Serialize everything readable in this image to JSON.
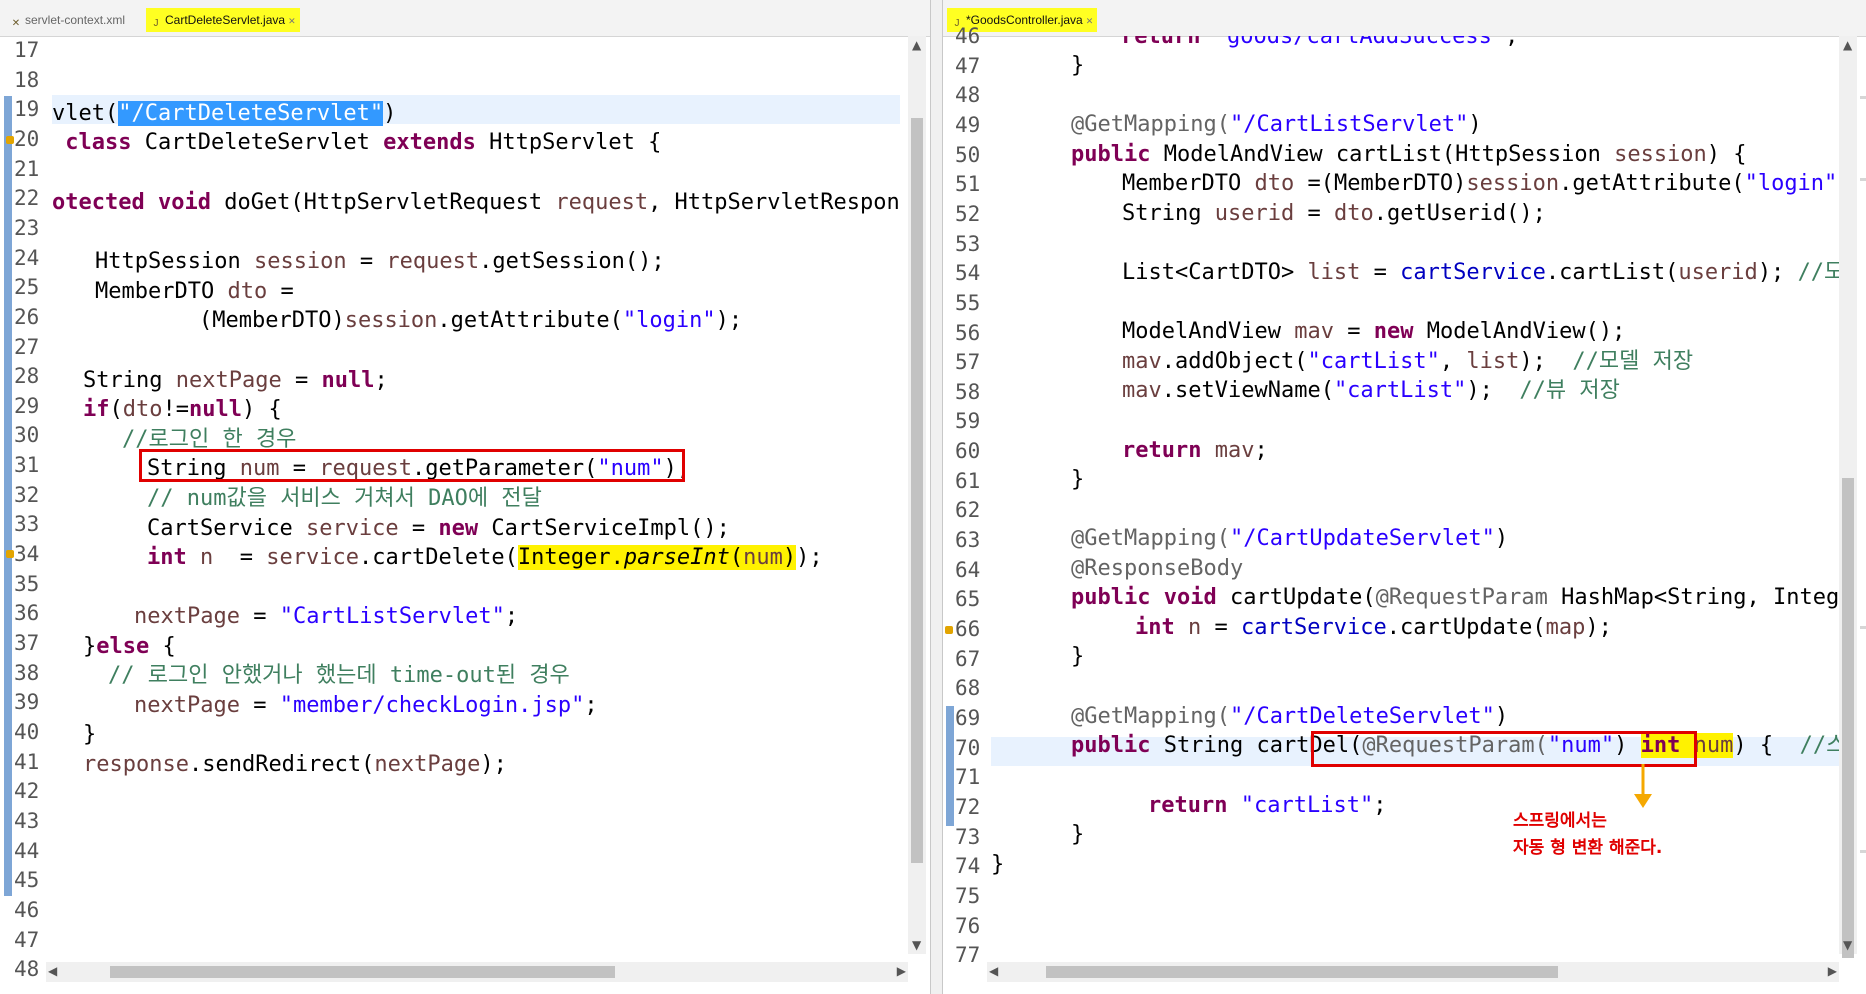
{
  "left": {
    "tabs": [
      {
        "label": "servlet-context.xml",
        "active": false
      },
      {
        "label": "CartDeleteServlet.java",
        "active": true
      }
    ],
    "line_numbers": [
      "17",
      "18",
      "19",
      "20",
      "21",
      "22",
      "23",
      "24",
      "25",
      "26",
      "27",
      "28",
      "29",
      "30",
      "31",
      "32",
      "33",
      "34",
      "35",
      "36",
      "37",
      "38",
      "39",
      "40",
      "41",
      "42",
      "43",
      "44",
      "45",
      "46",
      "47",
      "48"
    ],
    "code": {
      "l19_a": "vlet(",
      "l19_sel": "\"/CartDeleteServlet\"",
      "l19_b": ")",
      "l20_kw1": "class",
      "l20_name": "CartDeleteServlet",
      "l20_kw2": "extends",
      "l20_rest": "HttpServlet {",
      "l22_a": "otected",
      "l22_kw": "void",
      "l22_b": "doGet(HttpServletRequest",
      "l22_v1": "request",
      "l22_c": ", HttpServletResponse r",
      "l24_a": "HttpSession",
      "l24_v": "session",
      "l24_b": "=",
      "l24_v2": "request",
      "l24_c": ".getSession();",
      "l25_a": "MemberDTO",
      "l25_v": "dto",
      "l25_b": "=",
      "l26_a": "(MemberDTO)",
      "l26_v": "session",
      "l26_b": ".getAttribute(",
      "l26_s": "\"login\"",
      "l26_c": ");",
      "l28_a": "String",
      "l28_v": "nextPage",
      "l28_b": "=",
      "l28_kw": "null",
      "l28_c": ";",
      "l29_kw": "if",
      "l29_a": "(",
      "l29_v": "dto",
      "l29_b": "!=",
      "l29_kw2": "null",
      "l29_c": ") {",
      "l30_cm": "//로그인 한 경우",
      "l31_a": "String",
      "l31_v": "num",
      "l31_b": "=",
      "l31_v2": "request",
      "l31_c": ".getParameter(",
      "l31_s": "\"num\"",
      "l31_d": ");",
      "l32_cm": "// num값을 서비스 거쳐서 DAO에 전달",
      "l33_a": "CartService",
      "l33_v": "service",
      "l33_b": "=",
      "l33_kw": "new",
      "l33_c": "CartServiceImpl();",
      "l34_kw": "int",
      "l34_v": "n",
      "l34_b": "=",
      "l34_v2": "service",
      "l34_c": ".cartDelete(",
      "l34_hl": "Integer.",
      "l34_it": "parseInt",
      "l34_d": "(",
      "l34_v3": "num",
      "l34_e": ")",
      "l34_f": ");",
      "l36_v": "nextPage",
      "l36_b": "=",
      "l36_s": "\"CartListServlet\"",
      "l36_c": ";",
      "l37_a": "}",
      "l37_kw": "else",
      "l37_b": "{",
      "l38_cm": "// 로그인 안했거나 했는데 time-out된 경우",
      "l39_v": "nextPage",
      "l39_b": "=",
      "l39_s": "\"member/checkLogin.jsp\"",
      "l39_c": ";",
      "l40_a": "}",
      "l41_v": "response",
      "l41_a": ".sendRedirect(",
      "l41_v2": "nextPage",
      "l41_b": ");"
    }
  },
  "right": {
    "tabs": [
      {
        "label": "*GoodsController.java",
        "active": true
      }
    ],
    "line_numbers": [
      "46",
      "47",
      "48",
      "49",
      "50",
      "51",
      "52",
      "53",
      "54",
      "55",
      "56",
      "57",
      "58",
      "59",
      "60",
      "61",
      "62",
      "63",
      "64",
      "65",
      "66",
      "67",
      "68",
      "69",
      "70",
      "71",
      "72",
      "73",
      "74",
      "75",
      "76",
      "77"
    ],
    "code": {
      "r46_kw": "return",
      "r46_s": "\"goods/cartAddSuccess\"",
      "r46_c": ";",
      "r47": "}",
      "r49_ann": "@GetMapping(",
      "r49_s": "\"/CartListServlet\"",
      "r49_b": ")",
      "r50_kw": "public",
      "r50_a": "ModelAndView cartList(HttpSession",
      "r50_v": "session",
      "r50_b": ") {",
      "r51_a": "MemberDTO",
      "r51_v": "dto",
      "r51_b": "=(MemberDTO)",
      "r51_v2": "session",
      "r51_c": ".getAttribute(",
      "r51_s": "\"login\"",
      "r51_d": ");",
      "r52_a": "String",
      "r52_v": "userid",
      "r52_b": "=",
      "r52_v2": "dto",
      "r52_c": ".getUserid();",
      "r54_a": "List<CartDTO>",
      "r54_v": "list",
      "r54_b": "=",
      "r54_f": "cartService",
      "r54_c": ".cartList(",
      "r54_v2": "userid",
      "r54_d": ");",
      "r54_cm": "//모델",
      "r56_a": "ModelAndView",
      "r56_v": "mav",
      "r56_b": "=",
      "r56_kw": "new",
      "r56_c": "ModelAndView();",
      "r57_v": "mav",
      "r57_a": ".addObject(",
      "r57_s": "\"cartList\"",
      "r57_b": ",",
      "r57_v2": "list",
      "r57_c": ");",
      "r57_cm": "//모델 저장",
      "r58_v": "mav",
      "r58_a": ".setViewName(",
      "r58_s": "\"cartList\"",
      "r58_b": ");",
      "r58_cm": "//뷰 저장",
      "r60_kw": "return",
      "r60_v": "mav",
      "r60_c": ";",
      "r61": "}",
      "r63_ann": "@GetMapping(",
      "r63_s": "\"/CartUpdateServlet\"",
      "r63_b": ")",
      "r64_ann": "@ResponseBody",
      "r65_kw": "public",
      "r65_kw2": "void",
      "r65_a": "cartUpdate(",
      "r65_ann": "@RequestParam",
      "r65_b": "HashMap<String, Integer>",
      "r66_kw": "int",
      "r66_v": "n",
      "r66_b": "=",
      "r66_f": "cartService",
      "r66_c": ".cartUpdate(",
      "r66_v2": "map",
      "r66_d": ");",
      "r67": "}",
      "r69_ann": "@GetMapping(",
      "r69_s": "\"/CartDeleteServlet\"",
      "r69_b": ")",
      "r70_kw": "public",
      "r70_a": "String cartDel",
      "r70_p": "(",
      "r70_ann": "@RequestParam(",
      "r70_s": "\"num\"",
      "r70_b": ")",
      "r70_kw2": "int",
      "r70_v": "num",
      "r70_c": ")",
      "r70_d": "{",
      "r70_cm": "//스프링",
      "r72_kw": "return",
      "r72_s": "\"cartList\"",
      "r72_c": ";",
      "r73": "}",
      "r74": "}"
    },
    "callout": [
      "스프링에서는",
      "자동 형 변환 해준다."
    ]
  },
  "colors": {
    "keyword": "#7f0055",
    "string": "#2a00ff",
    "comment": "#3f7f5f",
    "annotation_box": "#e00000",
    "highlight": "#fff200",
    "tab_active": "#ffff22",
    "arrow": "#f5a800"
  },
  "icons": [
    "java-file-icon",
    "xml-file-icon",
    "close-icon",
    "scroll-up-icon",
    "scroll-down-icon",
    "scroll-left-icon",
    "scroll-right-icon",
    "arrow-down-icon"
  ]
}
